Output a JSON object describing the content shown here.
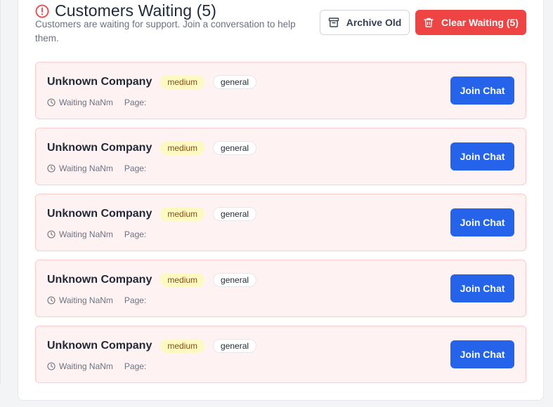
{
  "header": {
    "title": "Customers Waiting (5)",
    "subtitle": "Customers are waiting for support. Join a conversation to help them.",
    "alert_icon": "alert-circle-icon"
  },
  "toolbar": {
    "archive_label": "Archive Old",
    "archive_icon": "archive-icon",
    "clear_label": "Clear Waiting (5)",
    "clear_icon": "trash-icon"
  },
  "colors": {
    "danger": "#ef4444",
    "primary": "#2563eb",
    "card_bg": "#fef2f2",
    "card_border": "#fecaca",
    "priority_bg": "#fef9c3",
    "priority_text": "#854d0e"
  },
  "waiting": [
    {
      "company": "Unknown Company",
      "priority": "medium",
      "category": "general",
      "waiting_text": "Waiting NaNm",
      "page_label": "Page:",
      "action_label": "Join Chat"
    },
    {
      "company": "Unknown Company",
      "priority": "medium",
      "category": "general",
      "waiting_text": "Waiting NaNm",
      "page_label": "Page:",
      "action_label": "Join Chat"
    },
    {
      "company": "Unknown Company",
      "priority": "medium",
      "category": "general",
      "waiting_text": "Waiting NaNm",
      "page_label": "Page:",
      "action_label": "Join Chat"
    },
    {
      "company": "Unknown Company",
      "priority": "medium",
      "category": "general",
      "waiting_text": "Waiting NaNm",
      "page_label": "Page:",
      "action_label": "Join Chat"
    },
    {
      "company": "Unknown Company",
      "priority": "medium",
      "category": "general",
      "waiting_text": "Waiting NaNm",
      "page_label": "Page:",
      "action_label": "Join Chat"
    }
  ]
}
